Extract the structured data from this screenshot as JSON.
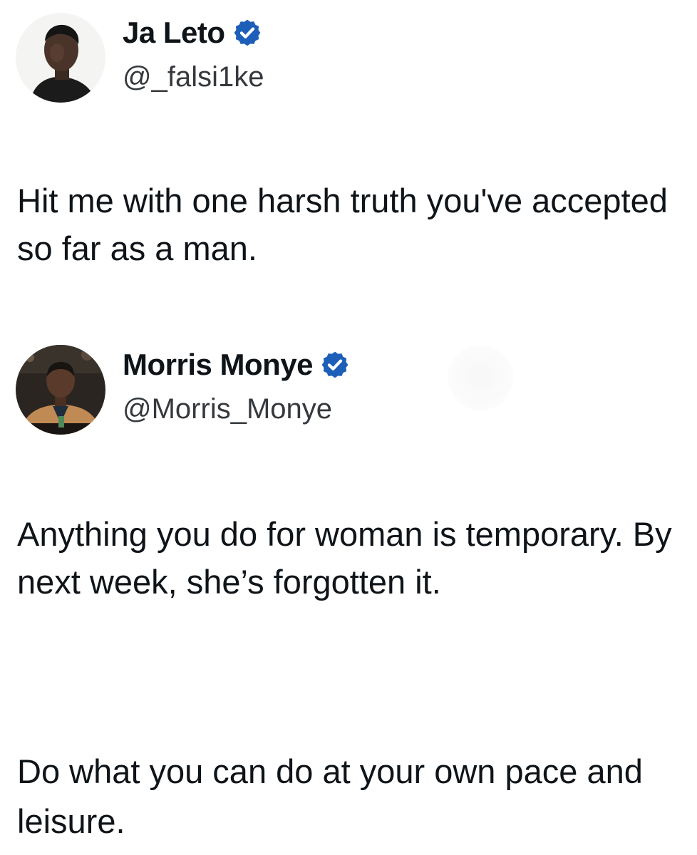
{
  "tweets": [
    {
      "author": {
        "display_name": "Ja Leto",
        "handle": "@_falsi1ke",
        "verified": true,
        "verified_color": "#1d5fb8"
      },
      "text": "Hit me with one harsh truth you've accepted so far as a man."
    },
    {
      "author": {
        "display_name": "Morris Monye",
        "handle": "@Morris_Monye",
        "verified": true,
        "verified_color": "#1d5fb8"
      },
      "paragraphs": [
        "Anything you do for woman is temporary. By next week, she’s forgotten it.",
        "Do what you can do at your own pace and leisure."
      ]
    }
  ],
  "icons": {
    "verified": "verified-badge-icon"
  }
}
